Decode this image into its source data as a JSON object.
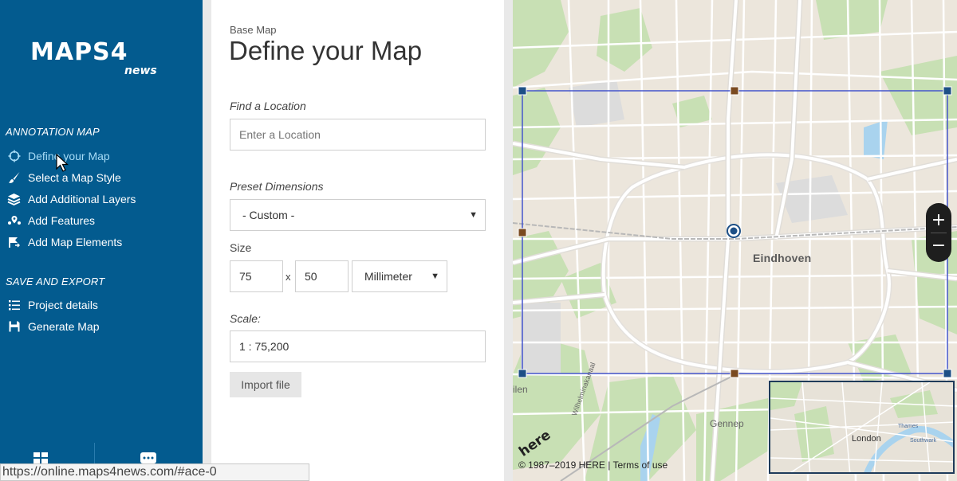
{
  "brand": {
    "logo_main": "MAPS4",
    "logo_sub": "news"
  },
  "sidebar": {
    "sections": [
      {
        "title": "ANNOTATION MAP",
        "items": [
          {
            "label": "Define your Map",
            "icon": "crosshair-icon",
            "active": true
          },
          {
            "label": "Select a Map Style",
            "icon": "brush-icon",
            "active": false
          },
          {
            "label": "Add Additional Layers",
            "icon": "layers-icon",
            "active": false
          },
          {
            "label": "Add Features",
            "icon": "features-icon",
            "active": false
          },
          {
            "label": "Add Map Elements",
            "icon": "map-elements-icon",
            "active": false
          }
        ]
      },
      {
        "title": "SAVE AND EXPORT",
        "items": [
          {
            "label": "Project details",
            "icon": "list-icon",
            "active": false
          },
          {
            "label": "Generate Map",
            "icon": "save-icon",
            "active": false
          }
        ]
      }
    ],
    "footer_icons": [
      "grid-icon",
      "chat-icon"
    ]
  },
  "form": {
    "eyebrow": "Base Map",
    "title": "Define your Map",
    "location": {
      "label": "Find a Location",
      "placeholder": "Enter a Location",
      "value": ""
    },
    "preset": {
      "label": "Preset Dimensions",
      "value": "- Custom -"
    },
    "size": {
      "label": "Size",
      "width": "75",
      "separator": "x",
      "height": "50",
      "unit": "Millimeter"
    },
    "scale": {
      "label": "Scale:",
      "value": "1 : 75,200"
    },
    "import_label": "Import file"
  },
  "map": {
    "city": "Eindhoven",
    "places": [
      "Gennep",
      "ilen"
    ],
    "street": "Wilhelminakanaal",
    "copyright": "© 1987–2019 HERE | Terms of use",
    "provider_logo": "here",
    "zoom_in": "+",
    "zoom_out": "−",
    "minimap": {
      "city": "London",
      "labels": [
        "Thames",
        "Southwark"
      ]
    },
    "colors": {
      "land": "#ece6dc",
      "park": "#c8e0b4",
      "water": "#a9d3ee",
      "road": "#ffffff",
      "selection": "#4455cc"
    }
  },
  "status_bar": {
    "url": "https://online.maps4news.com/#ace-0"
  },
  "colors": {
    "sidebar": "#035b8f",
    "active": "#a7dcf7"
  }
}
